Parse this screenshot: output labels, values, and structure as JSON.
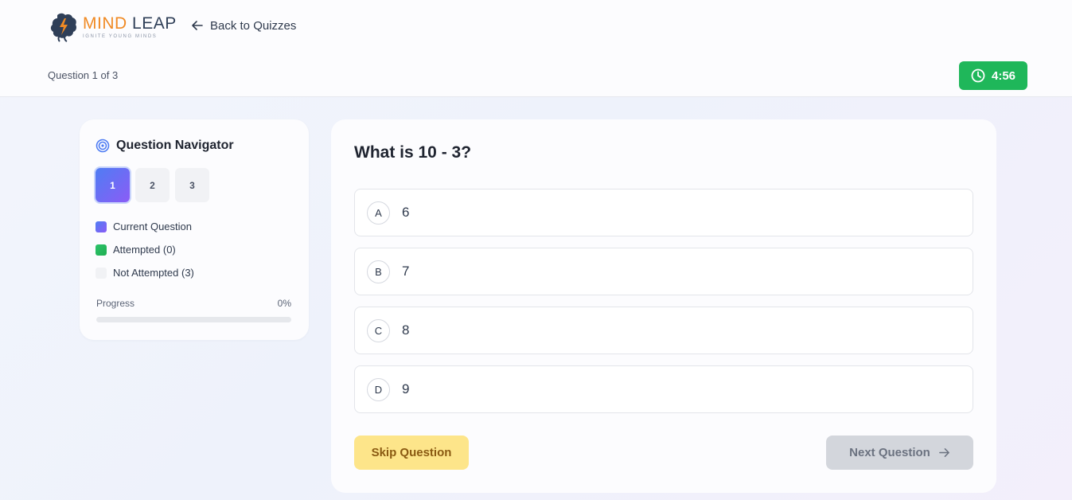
{
  "header": {
    "logo": {
      "name_part1": "MIND",
      "name_part2": "LEAP",
      "tagline": "IGNITE YOUNG MINDS"
    },
    "back_label": "Back to Quizzes",
    "question_counter": "Question 1 of 3",
    "timer": "4:56"
  },
  "navigator": {
    "title": "Question Navigator",
    "buttons": [
      "1",
      "2",
      "3"
    ],
    "current_index": 0,
    "legend": {
      "current": "Current Question",
      "attempted": "Attempted (0)",
      "not_attempted": "Not Attempted (3)"
    },
    "progress_label": "Progress",
    "progress_value": "0%",
    "progress_fraction": 0
  },
  "question": {
    "text": "What is 10 - 3?",
    "options": [
      {
        "letter": "A",
        "value": "6"
      },
      {
        "letter": "B",
        "value": "7"
      },
      {
        "letter": "C",
        "value": "8"
      },
      {
        "letter": "D",
        "value": "9"
      }
    ]
  },
  "actions": {
    "skip_label": "Skip Question",
    "next_label": "Next Question"
  },
  "colors": {
    "timer_bg": "#1fb75a",
    "current_gradient_start": "#4f7df3",
    "current_gradient_end": "#8b5cf6",
    "attempted": "#2dc36a",
    "skip_bg": "#fde58a",
    "skip_text": "#8a5a12",
    "next_disabled_bg": "#d3d6dc"
  }
}
